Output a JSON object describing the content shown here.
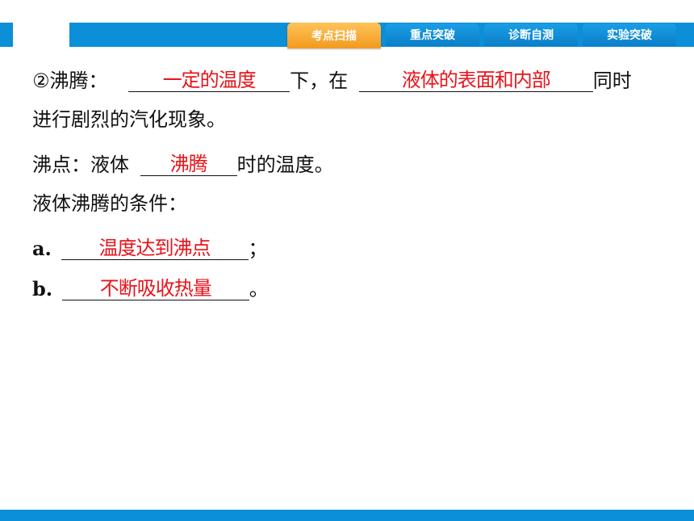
{
  "nav": {
    "tabs": [
      {
        "label": "考点扫描",
        "active": true
      },
      {
        "label": "重点突破",
        "active": false
      },
      {
        "label": "诊断自测",
        "active": false
      },
      {
        "label": "实验突破",
        "active": false
      }
    ]
  },
  "content": {
    "line1": {
      "prefix": "②沸腾：",
      "blank1": "一定的温度",
      "mid": "下，在",
      "blank2": "液体的表面和内部",
      "suffix": "同时"
    },
    "line2": "进行剧烈的汽化现象。",
    "line3": {
      "prefix": "沸点：液体",
      "blank": "沸腾",
      "suffix": "时的温度。"
    },
    "line4": "液体沸腾的条件：",
    "line5": {
      "label": "a.",
      "blank": "温度达到沸点",
      "suffix": "；"
    },
    "line6": {
      "label": "b.",
      "blank": "不断吸收热量",
      "suffix": "。"
    }
  },
  "colors": {
    "brand_blue": "#0b8fd8",
    "active_tab": "#f29a1e",
    "answer_red": "#e8141b"
  }
}
